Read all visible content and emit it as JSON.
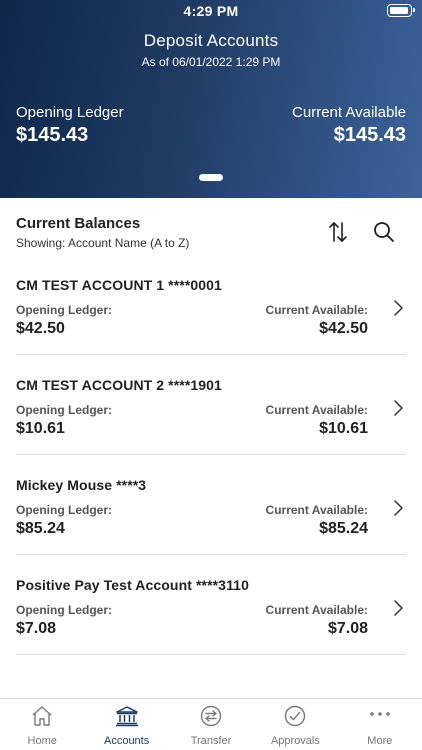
{
  "status_bar": {
    "time": "4:29 PM"
  },
  "header": {
    "title": "Deposit Accounts",
    "subtitle": "As of 06/01/2022 1:29 PM",
    "opening_ledger_label": "Opening Ledger",
    "opening_ledger_value": "$145.43",
    "current_available_label": "Current Available",
    "current_available_value": "$145.43"
  },
  "balances": {
    "title": "Current Balances",
    "subtitle": "Showing: Account Name (A to Z)",
    "accounts": [
      {
        "name": "CM TEST ACCOUNT 1 ****0001",
        "opening_label": "Opening Ledger:",
        "opening_value": "$42.50",
        "available_label": "Current Available:",
        "available_value": "$42.50"
      },
      {
        "name": "CM TEST ACCOUNT 2 ****1901",
        "opening_label": "Opening Ledger:",
        "opening_value": "$10.61",
        "available_label": "Current Available:",
        "available_value": "$10.61"
      },
      {
        "name": "Mickey Mouse ****3",
        "opening_label": "Opening Ledger:",
        "opening_value": "$85.24",
        "available_label": "Current Available:",
        "available_value": "$85.24"
      },
      {
        "name": "Positive Pay Test Account ****3110",
        "opening_label": "Opening Ledger:",
        "opening_value": "$7.08",
        "available_label": "Current Available:",
        "available_value": "$7.08"
      }
    ]
  },
  "tab_bar": {
    "items": [
      {
        "label": "Home",
        "icon": "home-icon"
      },
      {
        "label": "Accounts",
        "icon": "bank-icon",
        "active": true
      },
      {
        "label": "Transfer",
        "icon": "transfer-icon"
      },
      {
        "label": "Approvals",
        "icon": "check-circle-icon"
      },
      {
        "label": "More",
        "icon": "more-icon"
      }
    ]
  },
  "colors": {
    "header_dark": "#0f2749",
    "header_light": "#3d639a",
    "active_tab": "#1f3a63",
    "inactive_tab": "#777777",
    "divider": "#dcdcdc"
  }
}
